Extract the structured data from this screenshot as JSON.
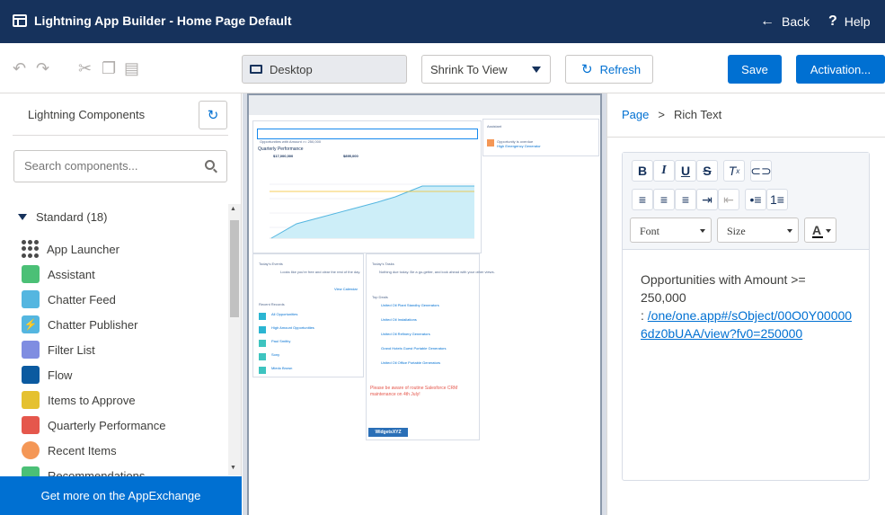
{
  "header": {
    "title": "Lightning App Builder - Home Page Default",
    "back": "Back",
    "help": "Help"
  },
  "toolbar": {
    "device": "Desktop",
    "zoom": "Shrink To View",
    "refresh": "Refresh",
    "save": "Save",
    "activation": "Activation..."
  },
  "left": {
    "title": "Lightning Components",
    "search_placeholder": "Search components...",
    "section": "Standard (18)",
    "items": [
      {
        "label": "App Launcher",
        "color": "#4a4a4a"
      },
      {
        "label": "Assistant",
        "color": "#4bc076"
      },
      {
        "label": "Chatter Feed",
        "color": "#54b6e0"
      },
      {
        "label": "Chatter Publisher",
        "color": "#54b6e0"
      },
      {
        "label": "Filter List",
        "color": "#7f8de1"
      },
      {
        "label": "Flow",
        "color": "#0b5aa0"
      },
      {
        "label": "Items to Approve",
        "color": "#e5c130"
      },
      {
        "label": "Quarterly Performance",
        "color": "#e5574c"
      },
      {
        "label": "Recent Items",
        "color": "#f49756"
      },
      {
        "label": "Recommendations",
        "color": "#4bc076"
      }
    ],
    "footer": "Get more on the AppExchange"
  },
  "canvas": {
    "opp_header": "Opportunities with Amount >= 250,000",
    "perf_title": "Quarterly Performance",
    "perf_closed": "$17,000,000",
    "perf_open": "$895,000",
    "assistant": "Assistant",
    "opp_item": "Opportunity is overdue",
    "opp_sub": "High Emergency Generator",
    "events": "Today's Events",
    "events_text": "Looks like you're free and clear the rest of the day.",
    "view_calendar": "View Calendar",
    "tasks": "Today's Tasks",
    "tasks_text": "Nothing due today. Be a go-getter, and look ahead with your other views.",
    "recent": "Recent Records",
    "recent_items": [
      "All Opportunities",
      "High Amount Opportunities",
      "Paul Smithy",
      "Sony",
      "Miedo Brown"
    ],
    "top_deals": "Top Deals",
    "deals": [
      "United Oil Plant Standby Generators",
      "United Oil Installations",
      "United Oil Refinery Generators",
      "Grand Hotels Guest Portable Generators",
      "United Oil Office Portable Generators"
    ],
    "notice": "Please be aware of routine Salesforce CRM maintenance on 4th July!",
    "logo": "WidgetsXYZ"
  },
  "right": {
    "breadcrumb_page": "Page",
    "breadcrumb_sep": ">",
    "breadcrumb_current": "Rich Text",
    "font": "Font",
    "size": "Size",
    "text": "Opportunities with Amount >= 250,000",
    "link_prefix": ": ",
    "link_text": "/one/one.app#/sObject/00O0Y000006dz0bUAA/view?fv0=250000"
  }
}
